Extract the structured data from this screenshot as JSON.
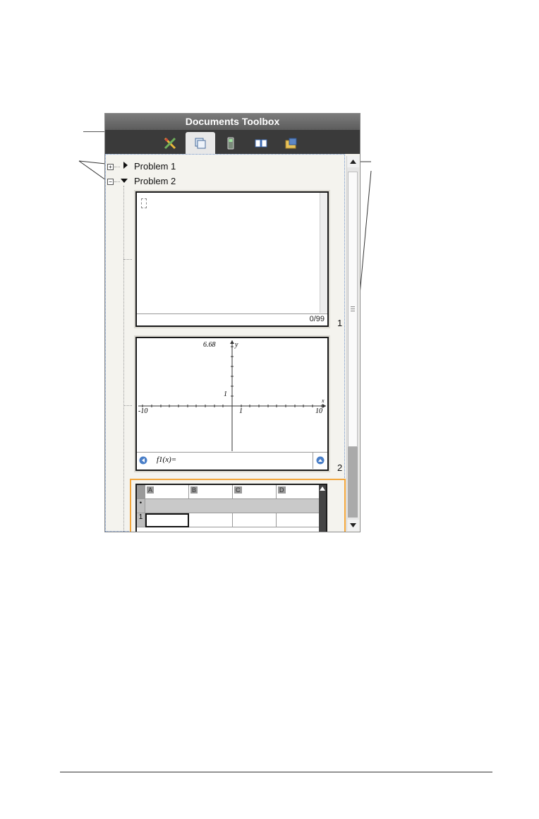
{
  "toolbox": {
    "title": "Documents Toolbox",
    "tabs": [
      {
        "icon": "document-tools-icon"
      },
      {
        "icon": "page-sorter-icon",
        "active": true
      },
      {
        "icon": "emulator-icon"
      },
      {
        "icon": "content-explorer-icon"
      },
      {
        "icon": "utilities-icon"
      }
    ]
  },
  "tree": {
    "problems": [
      {
        "label": "Problem 1",
        "expanded": false,
        "toggle": "+"
      },
      {
        "label": "Problem 2",
        "expanded": true,
        "toggle": "−"
      }
    ]
  },
  "pages": [
    {
      "number": "1",
      "counter": "0/99"
    },
    {
      "number": "2",
      "graph": {
        "y_max": "6.68",
        "y_label": "y",
        "x_label": "x",
        "x_min": "-10",
        "x_max": "10",
        "tick_x": "1",
        "tick_y": "1",
        "entry": "f1(x)="
      }
    },
    {
      "number": "",
      "columns": [
        "A",
        "B",
        "C",
        "D"
      ],
      "row": "1"
    }
  ]
}
